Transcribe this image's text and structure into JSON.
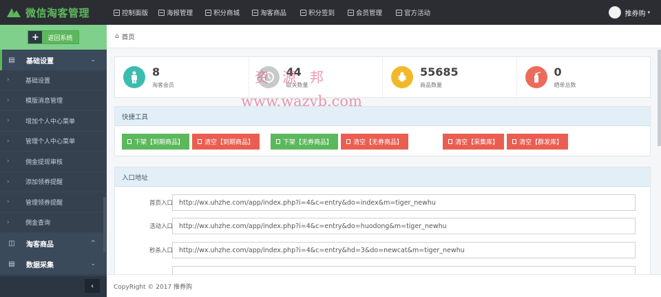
{
  "app": {
    "title": "微信淘客管理"
  },
  "topnav": [
    {
      "label": "控制面版"
    },
    {
      "label": "海报管理"
    },
    {
      "label": "积分商城"
    },
    {
      "label": "淘客商品"
    },
    {
      "label": "积分签到"
    },
    {
      "label": "会员管理"
    },
    {
      "label": "官方活动"
    }
  ],
  "user": {
    "name": "推券购",
    "caret": "▾"
  },
  "sidebar": {
    "back_label": "返回系统",
    "back_icon": "+",
    "group1": {
      "label": "基础设置",
      "chevron": "⌄"
    },
    "items": [
      {
        "label": "基础设置"
      },
      {
        "label": "模版消息管理"
      },
      {
        "label": "增加个人中心菜单"
      },
      {
        "label": "管理个人中心菜单"
      },
      {
        "label": "佣金提现审核"
      },
      {
        "label": "添加领券提醒"
      },
      {
        "label": "管理领券提醒"
      },
      {
        "label": "佣金查询"
      }
    ],
    "group2": {
      "label": "淘客商品",
      "chevron": "^"
    },
    "group3": {
      "label": "数据采集",
      "chevron": "⌄"
    },
    "collapse_icon": "‹"
  },
  "breadcrumb": {
    "label": "首页"
  },
  "stats": [
    {
      "value": "8",
      "label": "淘客会员",
      "color": "#3cbcb0"
    },
    {
      "value": "44",
      "label": "取关数量",
      "color": "#c7c9cb"
    },
    {
      "value": "55685",
      "label": "商品数量",
      "color": "#f3b82a"
    },
    {
      "value": "0",
      "label": "晒单总数",
      "color": "#ed6b5b"
    }
  ],
  "watermark": {
    "line1": "资源邦",
    "line2": "www.wazyb.com"
  },
  "tools_panel": {
    "title": "快捷工具",
    "buttons": [
      {
        "label": "下架【到期商品】",
        "color": "#5cb85c"
      },
      {
        "label": "清空【到期商品】",
        "color": "#ea5e52"
      },
      {
        "label": "下架【无券商品】",
        "color": "#5cb85c"
      },
      {
        "label": "清空【无券商品】",
        "color": "#ea5e52"
      },
      {
        "label": "清空【采集库】",
        "color": "#ea5e52"
      },
      {
        "label": "清空【群发库】",
        "color": "#ea5e52"
      }
    ]
  },
  "entry_panel": {
    "title": "入口地址",
    "rows": [
      {
        "label": "首页入口",
        "value": "http://wx.uhzhe.com/app/index.php?i=4&c=entry&do=index&m=tiger_newhu"
      },
      {
        "label": "活动入口",
        "value": "http://wx.uhzhe.com/app/index.php?i=4&c=entry&do=huodong&m=tiger_newhu"
      },
      {
        "label": "秒杀入口",
        "value": "http://wx.uhzhe.com/app/index.php?i=4&c=entry&hd=3&do=newcat&m=tiger_newhu"
      },
      {
        "label": "",
        "value": ""
      }
    ]
  },
  "footer": {
    "text": "CopyRight © 2017 推券购"
  }
}
